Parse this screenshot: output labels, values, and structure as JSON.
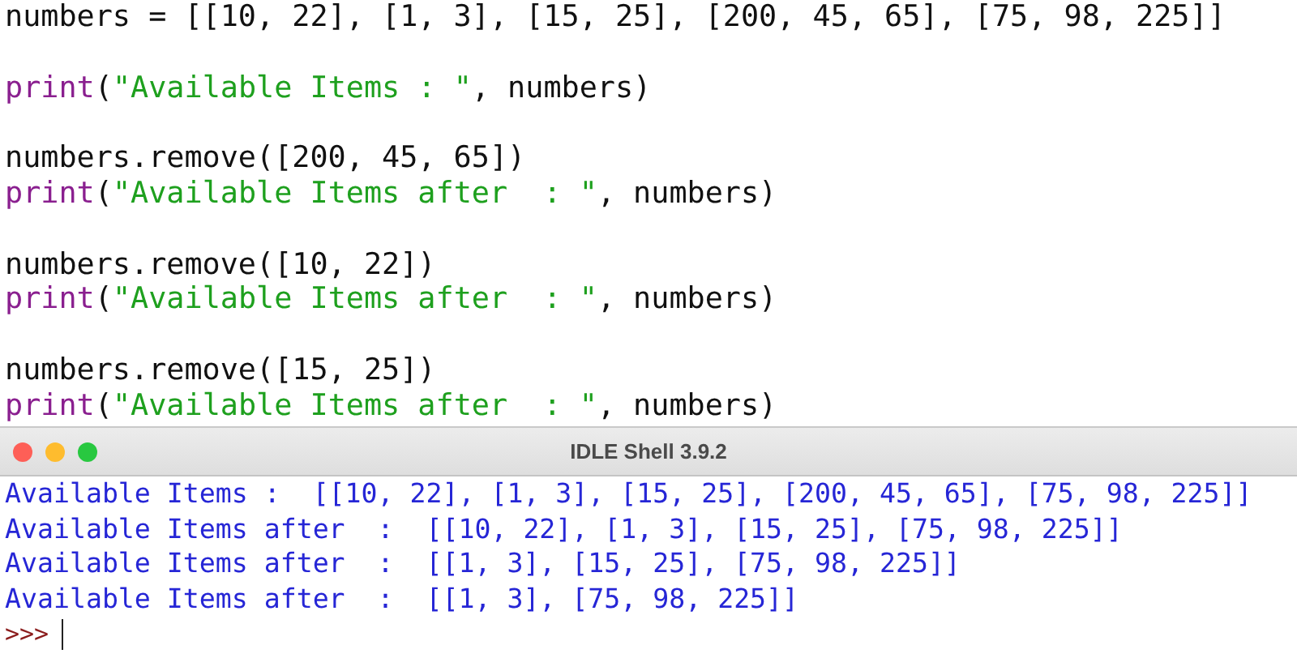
{
  "editor": {
    "blocks": [
      [
        [
          {
            "kind": "plain",
            "text": "numbers = [[10, 22], [1, 3], [15, 25], [200, 45, 65], [75, 98, 225]]"
          }
        ]
      ],
      [
        [
          {
            "kind": "builtin",
            "text": "print"
          },
          {
            "kind": "plain",
            "text": "("
          },
          {
            "kind": "string",
            "text": "\"Available Items : \""
          },
          {
            "kind": "plain",
            "text": ", numbers)"
          }
        ]
      ],
      [
        [
          {
            "kind": "plain",
            "text": "numbers.remove([200, 45, 65])"
          }
        ],
        [
          {
            "kind": "builtin",
            "text": "print"
          },
          {
            "kind": "plain",
            "text": "("
          },
          {
            "kind": "string",
            "text": "\"Available Items after  : \""
          },
          {
            "kind": "plain",
            "text": ", numbers)"
          }
        ]
      ],
      [
        [
          {
            "kind": "plain",
            "text": "numbers.remove([10, 22])"
          }
        ],
        [
          {
            "kind": "builtin",
            "text": "print"
          },
          {
            "kind": "plain",
            "text": "("
          },
          {
            "kind": "string",
            "text": "\"Available Items after  : \""
          },
          {
            "kind": "plain",
            "text": ", numbers)"
          }
        ]
      ],
      [
        [
          {
            "kind": "plain",
            "text": "numbers.remove([15, 25])"
          }
        ],
        [
          {
            "kind": "builtin",
            "text": "print"
          },
          {
            "kind": "plain",
            "text": "("
          },
          {
            "kind": "string",
            "text": "\"Available Items after  : \""
          },
          {
            "kind": "plain",
            "text": ", numbers)"
          }
        ]
      ]
    ]
  },
  "shell": {
    "title": "IDLE Shell 3.9.2",
    "output": [
      "Available Items :  [[10, 22], [1, 3], [15, 25], [200, 45, 65], [75, 98, 225]]",
      "Available Items after  :  [[10, 22], [1, 3], [15, 25], [75, 98, 225]]",
      "Available Items after  :  [[1, 3], [15, 25], [75, 98, 225]]",
      "Available Items after  :  [[1, 3], [75, 98, 225]]"
    ],
    "prompt": ">>>"
  }
}
